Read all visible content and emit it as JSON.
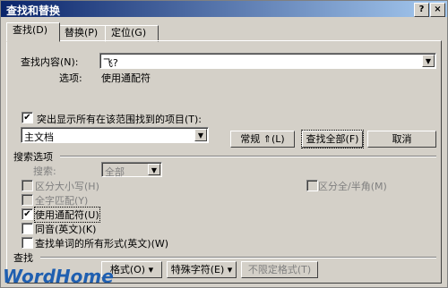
{
  "window": {
    "title": "查找和替换",
    "help_label": "?",
    "close_label": "×"
  },
  "tabs": [
    {
      "label": "查找(D)"
    },
    {
      "label": "替换(P)"
    },
    {
      "label": "定位(G)"
    }
  ],
  "find": {
    "label": "查找内容(N):",
    "value": "飞?",
    "options_label": "选项:",
    "options_value": "使用通配符"
  },
  "highlight": {
    "label": "突出显示所有在该范围找到的项目(T):",
    "checked": true,
    "scope_value": "主文档"
  },
  "buttons": {
    "normal": "常规 ⇑(L)",
    "find_all": "查找全部(F)",
    "cancel": "取消",
    "format": "格式(O) ▾",
    "special": "特殊字符(E) ▾",
    "no_format": "不限定格式(T)"
  },
  "search_options": {
    "header": "搜索选项",
    "search_label": "搜索:",
    "search_value": "全部",
    "match_case": "区分大小写(H)",
    "whole_word": "全字匹配(Y)",
    "wildcards": "使用通配符(U)",
    "sounds_like": "同音(英文)(K)",
    "word_forms": "查找单词的所有形式(英文)(W)",
    "full_half_width": "区分全/半角(M)"
  },
  "bottom": {
    "header": "查找"
  },
  "watermark": "WordHome"
}
